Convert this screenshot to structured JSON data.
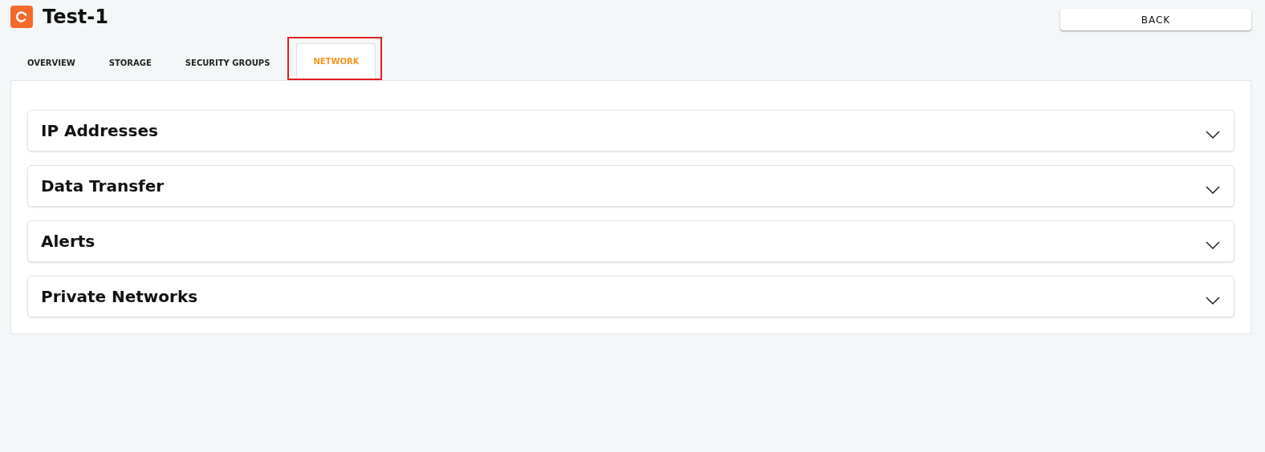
{
  "header": {
    "title": "Test-1",
    "back_button": "BACK"
  },
  "tabs": [
    {
      "label": "OVERVIEW",
      "selected": false
    },
    {
      "label": "STORAGE",
      "selected": false
    },
    {
      "label": "SECURITY GROUPS",
      "selected": false
    },
    {
      "label": "NETWORK",
      "selected": true
    }
  ],
  "sections": [
    {
      "title": "IP Addresses",
      "expanded": false
    },
    {
      "title": "Data Transfer",
      "expanded": false
    },
    {
      "title": "Alerts",
      "expanded": false
    },
    {
      "title": "Private Networks",
      "expanded": false
    }
  ]
}
